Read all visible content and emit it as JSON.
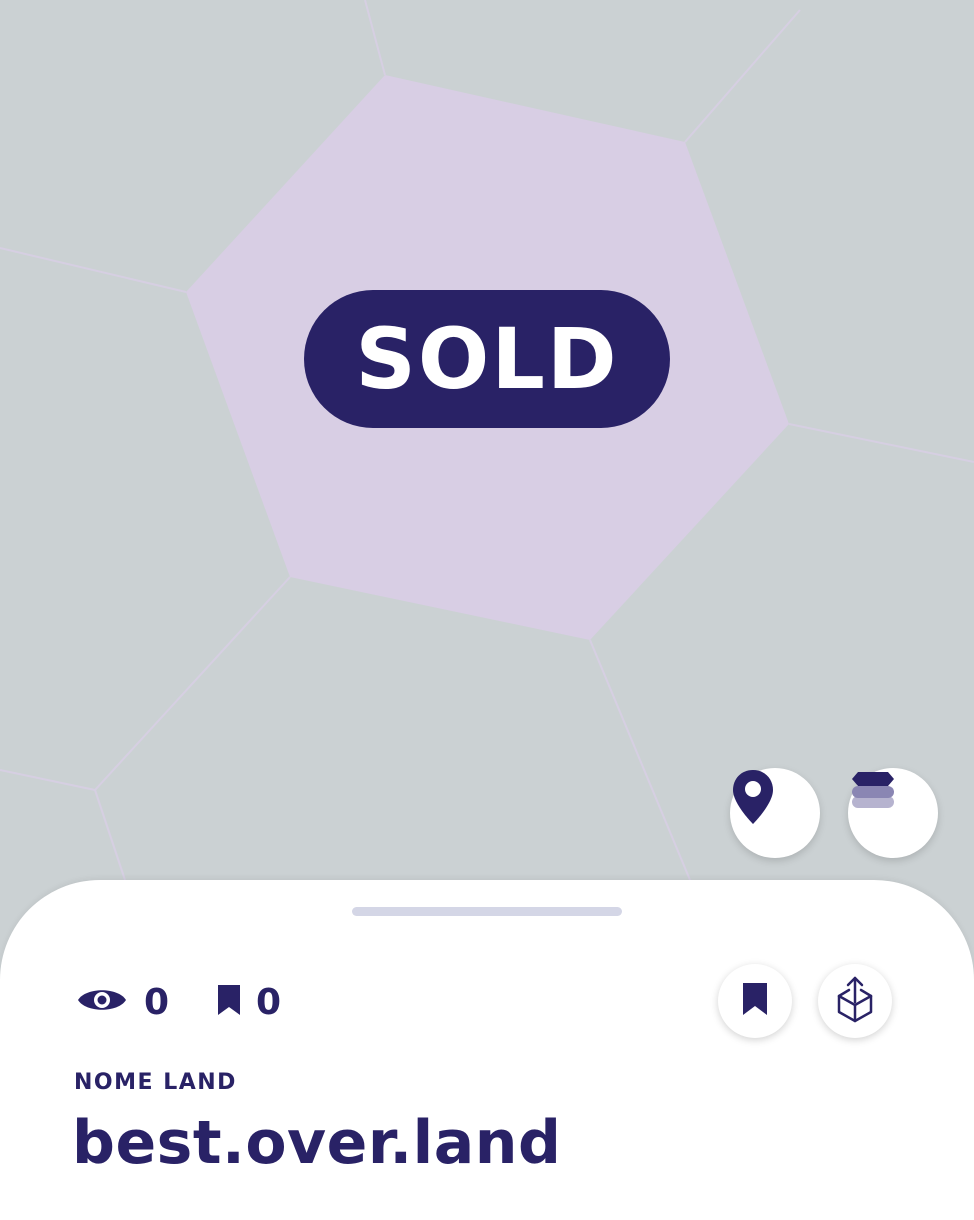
{
  "map": {
    "status_badge": "SOLD",
    "colors": {
      "background": "#cbd1d3",
      "selected_parcel": "#d8cee4",
      "parcel_lines": "#d6cfe2",
      "brand": "#292266"
    }
  },
  "map_controls": {
    "location_icon": "map-pin-icon",
    "layers_icon": "layers-icon"
  },
  "sheet": {
    "views_icon": "eye-icon",
    "views_count": "0",
    "bookmarks_icon": "bookmark-icon",
    "bookmarks_count": "0",
    "bookmark_button_icon": "bookmark-icon",
    "share_button_icon": "share-icon",
    "category": "NOME LAND",
    "title": "best.over.land"
  }
}
